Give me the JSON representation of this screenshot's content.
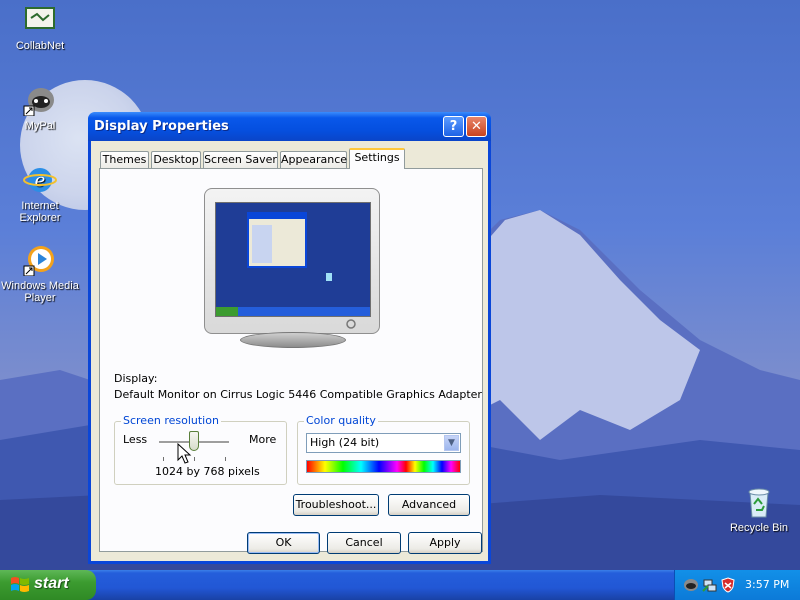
{
  "desktop": {
    "icons": [
      {
        "label": "CollabNet",
        "icon": "collabnet-icon"
      },
      {
        "label": "MyPal",
        "icon": "raccoon-icon"
      },
      {
        "label": "Internet Explorer",
        "icon": "internet-explorer-icon"
      },
      {
        "label": "Windows Media Player",
        "icon": "media-player-icon"
      },
      {
        "label": "Recycle Bin",
        "icon": "recycle-bin-icon"
      }
    ]
  },
  "window": {
    "title": "Display Properties",
    "help_glyph": "?",
    "close_glyph": "✕",
    "tabs": [
      "Themes",
      "Desktop",
      "Screen Saver",
      "Appearance",
      "Settings"
    ],
    "active_tab": "Settings",
    "display_label": "Display:",
    "display_value": "Default Monitor on Cirrus Logic 5446 Compatible Graphics Adapter",
    "resolution": {
      "legend": "Screen resolution",
      "less": "Less",
      "more": "More",
      "value": "1024 by 768 pixels",
      "slider_fraction": 0.5
    },
    "color_quality": {
      "legend": "Color quality",
      "selected": "High (24 bit)"
    },
    "buttons": {
      "troubleshoot": "Troubleshoot...",
      "advanced": "Advanced",
      "ok": "OK",
      "cancel": "Cancel",
      "apply": "Apply"
    }
  },
  "taskbar": {
    "start_label": "start",
    "clock": "3:57 PM"
  },
  "colors": {
    "window_frame": "#0a46d8",
    "dialog_face": "#ece9d8",
    "accent_tab": "#ffc83c",
    "group_legend": "#0046d5",
    "taskbar": "#245edb",
    "start_button": "#3c9c30"
  }
}
